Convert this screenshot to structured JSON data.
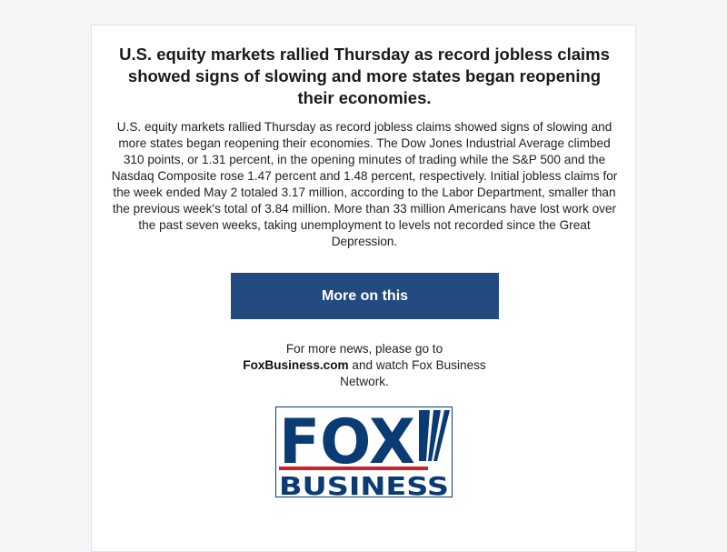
{
  "article": {
    "headline": "U.S. equity markets rallied Thursday as record jobless claims showed signs of slowing and more states began reopening their economies.",
    "body": "U.S. equity markets rallied Thursday as record jobless claims showed signs of slowing and more states began reopening their economies. The Dow Jones Industrial Average climbed 310 points, or 1.31 percent, in the opening minutes of trading while the S&P 500 and the Nasdaq Composite rose 1.47 percent and 1.48 percent, respectively. Initial jobless claims for the week ended May 2 totaled 3.17 million, according to the Labor Department, smaller than the previous week's total of 3.84 million. More than 33 million Americans have lost work over the past seven weeks, taking unemployment to levels not recorded since the Great Depression."
  },
  "cta": {
    "label": "More on this"
  },
  "footer": {
    "prefix": "For more news, please go to",
    "link_text": "FoxBusiness.com",
    "suffix": "and watch Fox Business Network."
  },
  "logo": {
    "top_text": "FOX",
    "bottom_text": "BUSINESS"
  },
  "colors": {
    "button_bg": "#244b80",
    "logo_navy": "#0b3b74",
    "logo_red": "#d11f2a"
  }
}
